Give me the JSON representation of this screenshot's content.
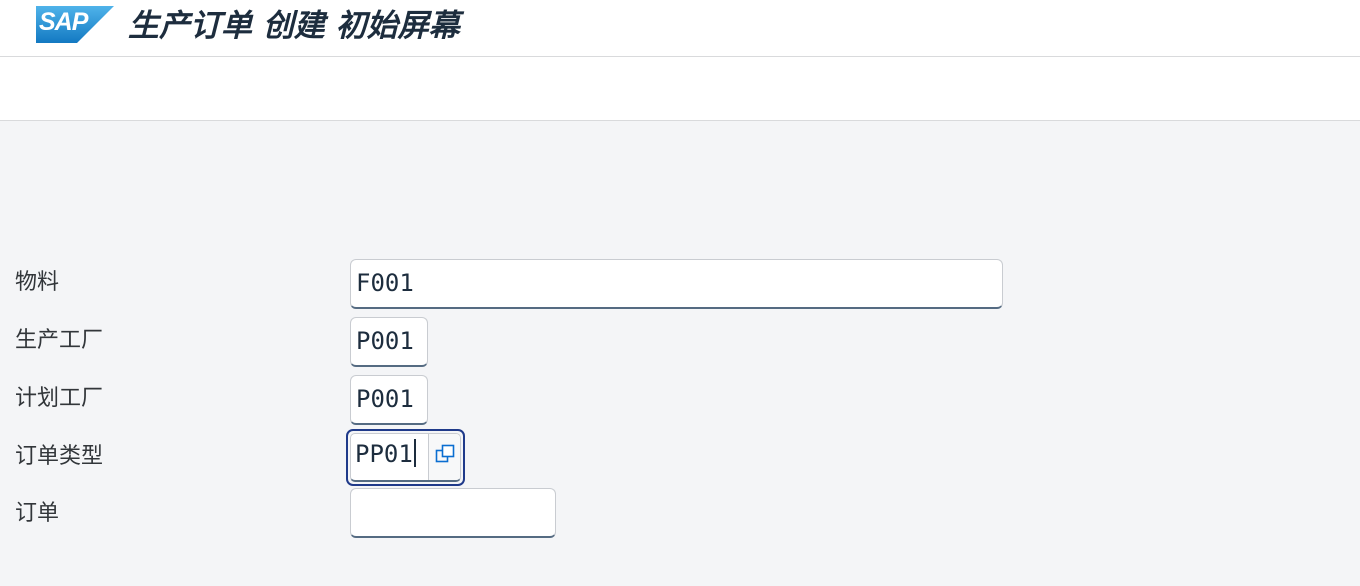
{
  "header": {
    "logo_text": "SAP",
    "title": "生产订单 创建 初始屏幕"
  },
  "form": {
    "fields": [
      {
        "label": "物料",
        "value": "F001"
      },
      {
        "label": "生产工厂",
        "value": "P001"
      },
      {
        "label": "计划工厂",
        "value": "P001"
      },
      {
        "label": "订单类型",
        "value": "PP01"
      },
      {
        "label": "订单",
        "value": ""
      }
    ]
  },
  "colors": {
    "logo_blue": "#1a8fd6",
    "focus_border": "#1f3a8a",
    "field_underline": "#556b82",
    "background": "#f4f5f7"
  },
  "icons": {
    "value_help": "value-help-icon"
  }
}
